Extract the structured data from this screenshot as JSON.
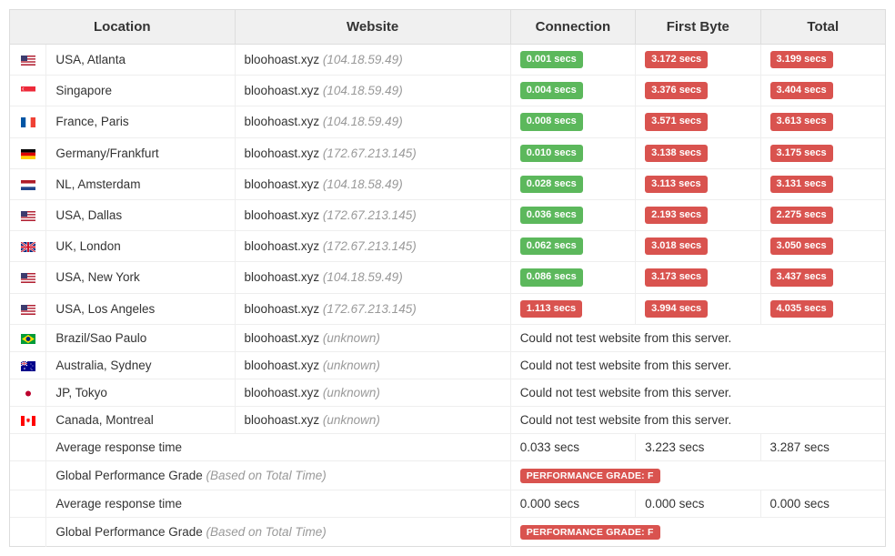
{
  "headers": {
    "location": "Location",
    "website": "Website",
    "connection": "Connection",
    "first_byte": "First Byte",
    "total": "Total"
  },
  "rows": [
    {
      "flag": "us",
      "location": "USA, Atlanta",
      "site": "bloohoast.xyz",
      "ip": "(104.18.59.49)",
      "conn": "0.001 secs",
      "conn_color": "green",
      "fb": "3.172 secs",
      "fb_color": "red",
      "total": "3.199 secs",
      "total_color": "red"
    },
    {
      "flag": "sg",
      "location": "Singapore",
      "site": "bloohoast.xyz",
      "ip": "(104.18.59.49)",
      "conn": "0.004 secs",
      "conn_color": "green",
      "fb": "3.376 secs",
      "fb_color": "red",
      "total": "3.404 secs",
      "total_color": "red"
    },
    {
      "flag": "fr",
      "location": "France, Paris",
      "site": "bloohoast.xyz",
      "ip": "(104.18.59.49)",
      "conn": "0.008 secs",
      "conn_color": "green",
      "fb": "3.571 secs",
      "fb_color": "red",
      "total": "3.613 secs",
      "total_color": "red"
    },
    {
      "flag": "de",
      "location": "Germany/Frankfurt",
      "site": "bloohoast.xyz",
      "ip": "(172.67.213.145)",
      "conn": "0.010 secs",
      "conn_color": "green",
      "fb": "3.138 secs",
      "fb_color": "red",
      "total": "3.175 secs",
      "total_color": "red"
    },
    {
      "flag": "nl",
      "location": "NL, Amsterdam",
      "site": "bloohoast.xyz",
      "ip": "(104.18.58.49)",
      "conn": "0.028 secs",
      "conn_color": "green",
      "fb": "3.113 secs",
      "fb_color": "red",
      "total": "3.131 secs",
      "total_color": "red"
    },
    {
      "flag": "us",
      "location": "USA, Dallas",
      "site": "bloohoast.xyz",
      "ip": "(172.67.213.145)",
      "conn": "0.036 secs",
      "conn_color": "green",
      "fb": "2.193 secs",
      "fb_color": "red",
      "total": "2.275 secs",
      "total_color": "red"
    },
    {
      "flag": "gb",
      "location": "UK, London",
      "site": "bloohoast.xyz",
      "ip": "(172.67.213.145)",
      "conn": "0.062 secs",
      "conn_color": "green",
      "fb": "3.018 secs",
      "fb_color": "red",
      "total": "3.050 secs",
      "total_color": "red"
    },
    {
      "flag": "us",
      "location": "USA, New York",
      "site": "bloohoast.xyz",
      "ip": "(104.18.59.49)",
      "conn": "0.086 secs",
      "conn_color": "green",
      "fb": "3.173 secs",
      "fb_color": "red",
      "total": "3.437 secs",
      "total_color": "red"
    },
    {
      "flag": "us",
      "location": "USA, Los Angeles",
      "site": "bloohoast.xyz",
      "ip": "(172.67.213.145)",
      "conn": "1.113 secs",
      "conn_color": "red",
      "fb": "3.994 secs",
      "fb_color": "red",
      "total": "4.035 secs",
      "total_color": "red"
    },
    {
      "flag": "br",
      "location": "Brazil/Sao Paulo",
      "site": "bloohoast.xyz",
      "ip": "(unknown)",
      "error": "Could not test website from this server."
    },
    {
      "flag": "au",
      "location": "Australia, Sydney",
      "site": "bloohoast.xyz",
      "ip": "(unknown)",
      "error": "Could not test website from this server."
    },
    {
      "flag": "jp",
      "location": "JP, Tokyo",
      "site": "bloohoast.xyz",
      "ip": "(unknown)",
      "error": "Could not test website from this server."
    },
    {
      "flag": "ca",
      "location": "Canada, Montreal",
      "site": "bloohoast.xyz",
      "ip": "(unknown)",
      "error": "Could not test website from this server."
    }
  ],
  "summary": [
    {
      "type": "avg",
      "label": "Average response time",
      "conn": "0.033 secs",
      "fb": "3.223 secs",
      "total": "3.287 secs"
    },
    {
      "type": "grade",
      "label": "Global Performance Grade",
      "note": "(Based on Total Time)",
      "badge": "PERFORMANCE GRADE:  F"
    },
    {
      "type": "avg",
      "label": "Average response time",
      "conn": "0.000 secs",
      "fb": "0.000 secs",
      "total": "0.000 secs"
    },
    {
      "type": "grade",
      "label": "Global Performance Grade",
      "note": "(Based on Total Time)",
      "badge": "PERFORMANCE GRADE:  F"
    }
  ],
  "flags": {
    "us": {
      "bars": [
        {
          "c": "#b22234",
          "h": 1.57
        },
        {
          "c": "#fff",
          "h": 1.57
        },
        {
          "c": "#b22234",
          "h": 1.57
        },
        {
          "c": "#fff",
          "h": 1.57
        },
        {
          "c": "#b22234",
          "h": 1.57
        },
        {
          "c": "#fff",
          "h": 1.57
        },
        {
          "c": "#b22234",
          "h": 1.58
        }
      ],
      "canton": {
        "w": 7,
        "h": 6,
        "c": "#3c3b6e"
      }
    },
    "sg": {
      "bars": [
        {
          "c": "#ed2939",
          "h": 5.5
        },
        {
          "c": "#fff",
          "h": 5.5
        }
      ]
    },
    "fr": {
      "cols": [
        {
          "c": "#0055a4",
          "w": 5.33
        },
        {
          "c": "#fff",
          "w": 5.34
        },
        {
          "c": "#ef4135",
          "w": 5.33
        }
      ]
    },
    "de": {
      "bars": [
        {
          "c": "#000",
          "h": 3.67
        },
        {
          "c": "#dd0000",
          "h": 3.67
        },
        {
          "c": "#ffce00",
          "h": 3.66
        }
      ]
    },
    "nl": {
      "bars": [
        {
          "c": "#ae1c28",
          "h": 3.67
        },
        {
          "c": "#fff",
          "h": 3.67
        },
        {
          "c": "#21468b",
          "h": 3.66
        }
      ]
    },
    "gb": {
      "bg": "#00247d",
      "cross": "#cf142b",
      "fimb": "#fff"
    },
    "br": {
      "bg": "#009b3a",
      "diamond": "#fedf00",
      "circle": "#002776"
    },
    "au": {
      "bg": "#00008b"
    },
    "jp": {
      "bg": "#fff",
      "circle": "#bc002d"
    },
    "ca": {
      "cols": [
        {
          "c": "#ff0000",
          "w": 4
        },
        {
          "c": "#fff",
          "w": 8
        },
        {
          "c": "#ff0000",
          "w": 4
        }
      ],
      "leaf": "#ff0000"
    }
  }
}
